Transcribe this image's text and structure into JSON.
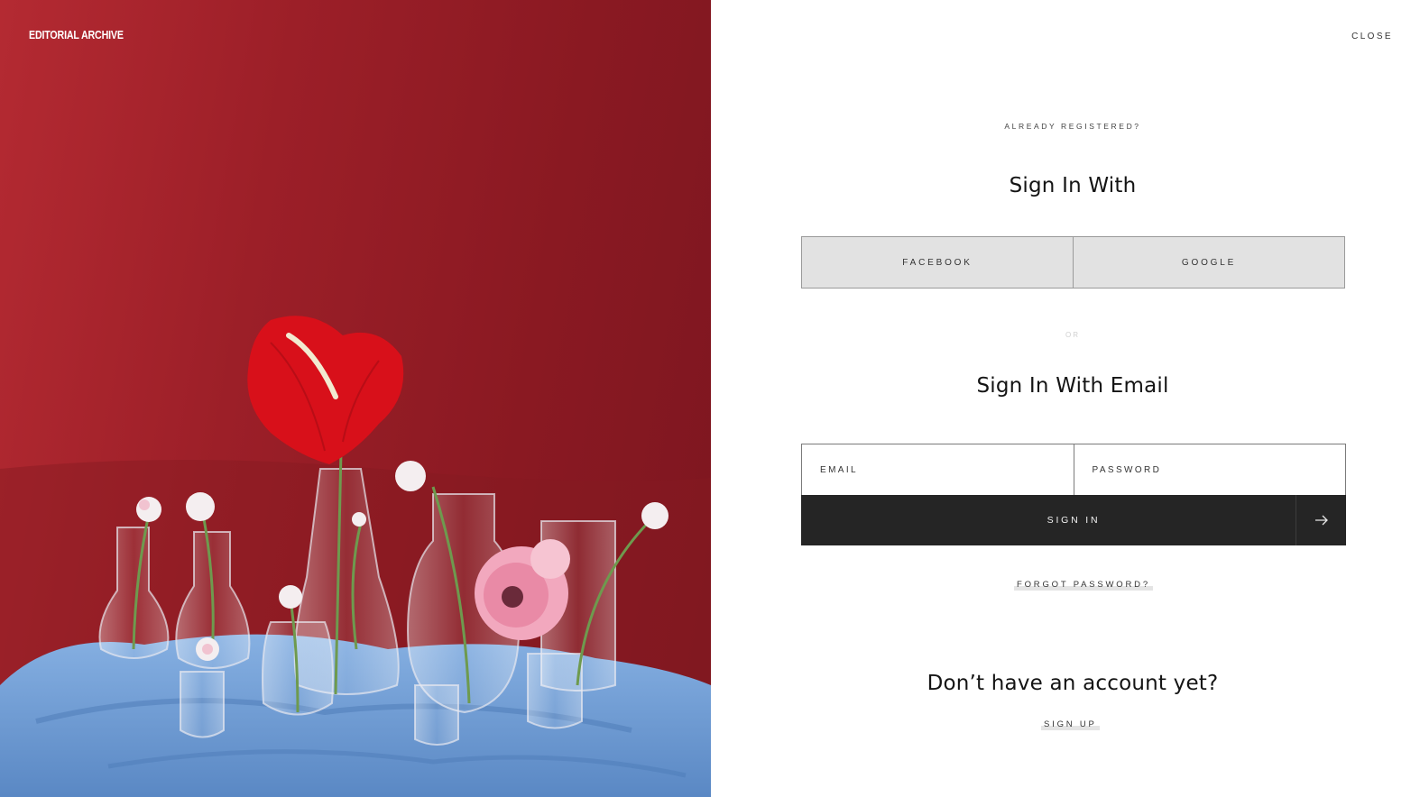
{
  "brand": {
    "logo_text": "EDITORIAL ARCHIVE"
  },
  "header": {
    "close_label": "CLOSE"
  },
  "signin": {
    "eyebrow": "ALREADY REGISTERED?",
    "social_heading": "Sign In With",
    "social_buttons": [
      "FACEBOOK",
      "GOOGLE"
    ],
    "divider": "OR",
    "email_heading": "Sign In With Email",
    "email_placeholder": "EMAIL",
    "password_placeholder": "PASSWORD",
    "submit_label": "SIGN IN",
    "submit_icon": "arrow-right-icon",
    "forgot_label": "FORGOT PASSWORD?"
  },
  "signup": {
    "heading": "Don’t have an account yet?",
    "link_label": "SIGN UP"
  },
  "colors": {
    "backdrop_red": "#9c1f28",
    "cloth_blue": "#6f9ed6",
    "submit_bg": "#252525",
    "social_bg": "#e2e2e2"
  }
}
